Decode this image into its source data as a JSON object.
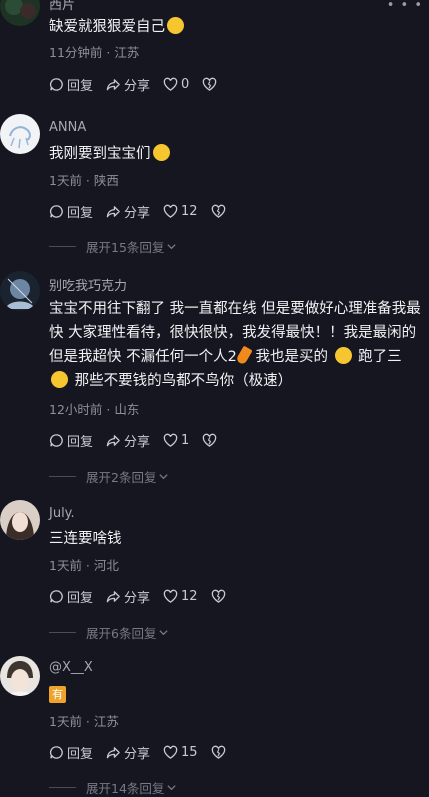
{
  "comments": [
    {
      "username": "西片",
      "text": "缺爱就狠狠爱自己",
      "emoji": "smile",
      "time": "11分钟前",
      "location": "江苏",
      "reply": "回复",
      "share": "分享",
      "likes": "0"
    },
    {
      "username": "ANNA",
      "text": "我刚要到宝宝们",
      "emoji": "grin",
      "time": "1天前",
      "location": "陕西",
      "reply": "回复",
      "share": "分享",
      "likes": "12",
      "expand": "展开15条回复"
    },
    {
      "username": "别吃我巧克力",
      "text_part1": "宝宝不用往下翻了 我一直都在线 但是要做好心理准备我最快 大家理性看待，很快很快，我发得最快！！我是最闲的但是我超快 不漏任何一个人2",
      "text_part2": " 我也是买的 ",
      "text_part3": " 跑了三",
      "text_part4": " 那些不要钱的鸟都不鸟你（极速）",
      "time": "12小时前",
      "location": "山东",
      "reply": "回复",
      "share": "分享",
      "likes": "1",
      "expand": "展开2条回复"
    },
    {
      "username": "July.",
      "text": "三连要啥钱",
      "time": "1天前",
      "location": "河北",
      "reply": "回复",
      "share": "分享",
      "likes": "12",
      "expand": "展开6条回复"
    },
    {
      "username": "@X__X",
      "badge": "有",
      "time": "1天前",
      "location": "江苏",
      "reply": "回复",
      "share": "分享",
      "likes": "15",
      "expand": "展开14条回复"
    }
  ],
  "meta_separator": " · ",
  "colors": {
    "background": "#15161f",
    "text_primary": "#f2f2f5",
    "text_secondary": "#8d8f9a",
    "badge": "#f0a32a"
  }
}
